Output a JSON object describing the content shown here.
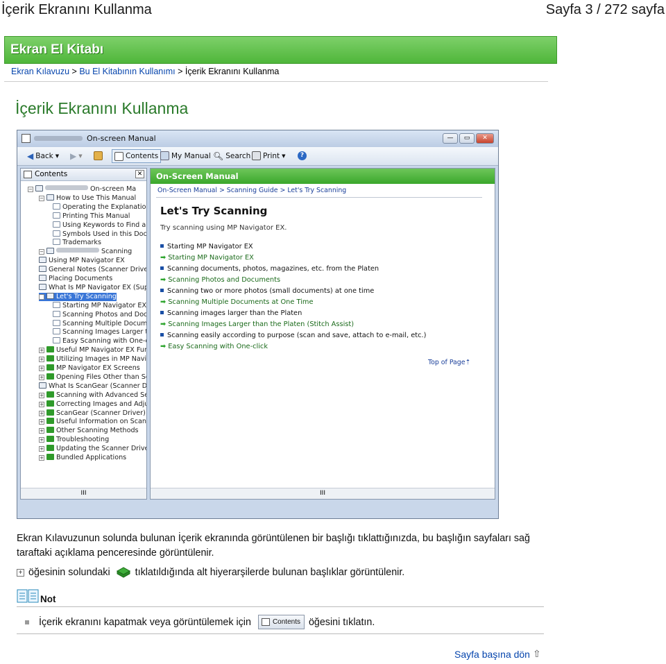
{
  "header": {
    "title": "İçerik Ekranını Kullanma",
    "page_info": "Sayfa 3 / 272 sayfa"
  },
  "banner": {
    "label": "Ekran El Kitabı",
    "color": "#5cbd45"
  },
  "breadcrumb": {
    "home": "Ekran Kılavuzu",
    "sep1": " > ",
    "section": "Bu El Kitabının Kullanımı",
    "sep2": " > ",
    "current": "İçerik Ekranını Kullanma"
  },
  "page_title": "İçerik Ekranını Kullanma",
  "window": {
    "title": "On-screen Manual",
    "toolbar": {
      "back": "Back",
      "contents": "Contents",
      "my_manual": "My Manual",
      "search": "Search",
      "print": "Print"
    },
    "contents_pane": {
      "header": "Contents",
      "tree": [
        {
          "label": "On-screen Ma",
          "level": 0,
          "blurred": true,
          "sign": "−"
        },
        {
          "label": "How to Use This Manual",
          "level": 1,
          "sign": "−"
        },
        {
          "label": "Operating the Explanation S",
          "level": 2
        },
        {
          "label": "Printing This Manual",
          "level": 2
        },
        {
          "label": "Using Keywords to Find a T",
          "level": 2
        },
        {
          "label": "Symbols Used in this Docu",
          "level": 2
        },
        {
          "label": "Trademarks",
          "level": 2
        },
        {
          "label": "Scanning",
          "level": 1,
          "blurred": true,
          "sign": "−"
        },
        {
          "label": "Using MP Navigator EX",
          "level": 1
        },
        {
          "label": "General Notes (Scanner Driver)",
          "level": 1
        },
        {
          "label": "Placing Documents",
          "level": 1
        },
        {
          "label": "What Is MP Navigator EX (Sup",
          "level": 1
        },
        {
          "label": "Let's Try Scanning",
          "level": 1,
          "sign": "−",
          "selected": true
        },
        {
          "label": "Starting MP Navigator EX",
          "level": 2
        },
        {
          "label": "Scanning Photos and Docu",
          "level": 2
        },
        {
          "label": "Scanning Multiple Documer",
          "level": 2
        },
        {
          "label": "Scanning Images Larger th",
          "level": 2
        },
        {
          "label": "Easy Scanning with One-cli",
          "level": 2
        },
        {
          "label": "Useful MP Navigator EX Functi",
          "level": 1,
          "sign": "+"
        },
        {
          "label": "Utilizing Images in MP Navigato",
          "level": 1,
          "sign": "+"
        },
        {
          "label": "MP Navigator EX Screens",
          "level": 1,
          "sign": "+"
        },
        {
          "label": "Opening Files Other than Scann",
          "level": 1,
          "sign": "+"
        },
        {
          "label": "What Is ScanGear (Scanner Dr",
          "level": 1
        },
        {
          "label": "Scanning with Advanced Settir",
          "level": 1,
          "sign": "+"
        },
        {
          "label": "Correcting Images and Adjustin",
          "level": 1,
          "sign": "+"
        },
        {
          "label": "ScanGear (Scanner Driver) Scr",
          "level": 1,
          "sign": "+"
        },
        {
          "label": "Useful Information on Scanning",
          "level": 1,
          "sign": "+"
        },
        {
          "label": "Other Scanning Methods",
          "level": 1,
          "sign": "+"
        },
        {
          "label": "Troubleshooting",
          "level": 1,
          "sign": "+"
        },
        {
          "label": "Updating the Scanner Driver",
          "level": 1,
          "sign": "+"
        },
        {
          "label": "Bundled Applications",
          "level": 1,
          "sign": "+"
        }
      ],
      "scroll_glyph": "III"
    },
    "content_pane": {
      "band": "On-Screen Manual",
      "crumb": "On-Screen Manual > Scanning Guide > Let's Try Scanning",
      "heading": "Let's Try Scanning",
      "intro": "Try scanning using MP Navigator EX.",
      "items": [
        {
          "text": "Starting MP Navigator EX",
          "kind": "bullet"
        },
        {
          "text": "Starting MP Navigator EX",
          "kind": "link"
        },
        {
          "text": "Scanning documents, photos, magazines, etc. from the Platen",
          "kind": "bullet"
        },
        {
          "text": "Scanning Photos and Documents",
          "kind": "link"
        },
        {
          "text": "Scanning two or more photos (small documents) at one time",
          "kind": "bullet"
        },
        {
          "text": "Scanning Multiple Documents at One Time",
          "kind": "link"
        },
        {
          "text": "Scanning images larger than the Platen",
          "kind": "bullet"
        },
        {
          "text": "Scanning Images Larger than the Platen (Stitch Assist)",
          "kind": "link"
        },
        {
          "text": "Scanning easily according to purpose (scan and save, attach to e-mail, etc.)",
          "kind": "bullet"
        },
        {
          "text": "Easy Scanning with One-click",
          "kind": "link"
        }
      ],
      "top_link": "Top of Page",
      "scroll_glyph": "III"
    }
  },
  "body": {
    "paragraph": "Ekran Kılavuzunun solunda bulunan İçerik ekranında görüntülenen bir başlığı tıklattığınızda, bu başlığın sayfaları sağ taraftaki açıklama penceresinde görüntülenir.",
    "expand_before": "öğesinin solundaki",
    "expand_after": "tıklatıldığında alt hiyerarşilerde bulunan başlıklar görüntülenir.",
    "plus_glyph": "+"
  },
  "note": {
    "label": "Not",
    "before": "İçerik ekranını kapatmak veya görüntülemek için",
    "button": "Contents",
    "after": "öğesini tıklatın."
  },
  "footer": {
    "to_top": "Sayfa başına dön"
  }
}
